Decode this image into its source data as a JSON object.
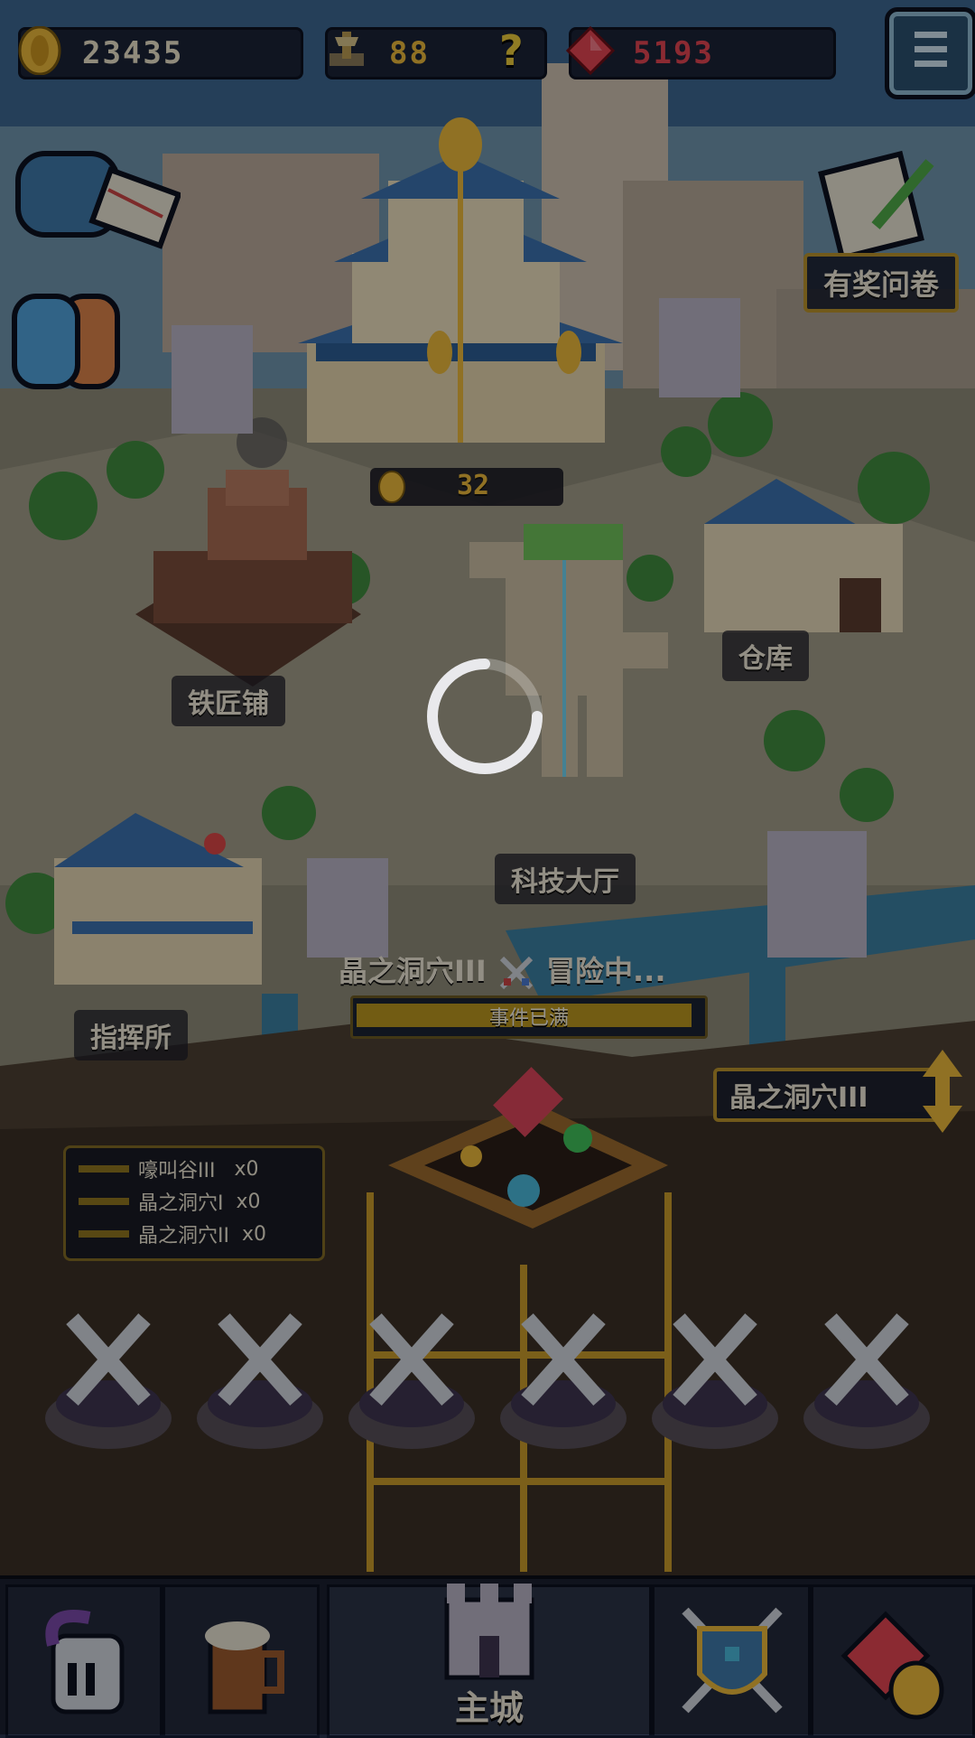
{
  "hud": {
    "gold": "23435",
    "hammer": "88",
    "help_symbol": "?",
    "gems": "5193"
  },
  "buildings": {
    "main_hall_income": "32",
    "smithy": "铁匠铺",
    "warehouse": "仓库",
    "tech_hall": "科技大厅",
    "command_post": "指挥所"
  },
  "survey": {
    "label": "有奖问卷"
  },
  "expedition": {
    "title": "晶之洞穴III",
    "status": "冒险中...",
    "bar_text": "事件已满",
    "bar_fill": 0.97,
    "selector": "晶之洞穴III"
  },
  "cave_list": [
    {
      "label": "嚎叫谷III",
      "count": "x0"
    },
    {
      "label": "晶之洞穴I",
      "count": "x0"
    },
    {
      "label": "晶之洞穴II",
      "count": "x0"
    }
  ],
  "nav": {
    "main_city": "主城"
  },
  "colors": {
    "gold": "#e8b63a",
    "gem": "#e04452",
    "accent_gold": "#b8922c"
  }
}
